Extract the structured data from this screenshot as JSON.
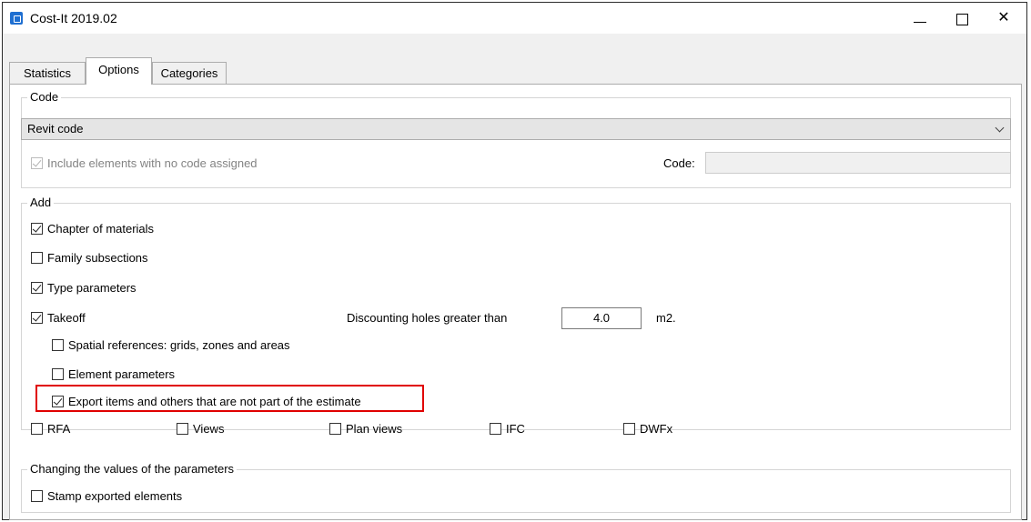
{
  "window": {
    "title": "Cost-It 2019.02",
    "minimize_glyph": "—",
    "maximize_glyph": "☐",
    "close_glyph": "✕"
  },
  "tabs": [
    {
      "label": "Statistics",
      "active": false
    },
    {
      "label": "Options",
      "active": true
    },
    {
      "label": "Categories",
      "active": false
    }
  ],
  "code_group": {
    "legend": "Code",
    "dropdown_value": "Revit code",
    "include_no_code": {
      "label": "Include elements with no code assigned",
      "checked": true,
      "enabled": false
    },
    "code_label": "Code:",
    "code_value": ""
  },
  "add_group": {
    "legend": "Add",
    "chapter_of_materials": {
      "label": "Chapter of materials",
      "checked": true
    },
    "family_subsections": {
      "label": "Family subsections",
      "checked": false
    },
    "type_parameters": {
      "label": "Type parameters",
      "checked": true
    },
    "takeoff": {
      "label": "Takeoff",
      "checked": true
    },
    "discounting_label": "Discounting holes greater than",
    "discounting_value": "4.0",
    "discounting_unit": "m2.",
    "spatial_references": {
      "label": "Spatial references: grids, zones and areas",
      "checked": false
    },
    "element_parameters": {
      "label": "Element parameters",
      "checked": false
    },
    "export_items": {
      "label": "Export items and others that are not part of the estimate",
      "checked": true,
      "highlighted": true
    },
    "rfa": {
      "label": "RFA",
      "checked": false
    },
    "views": {
      "label": "Views",
      "checked": false
    },
    "plan_views": {
      "label": "Plan views",
      "checked": false
    },
    "ifc": {
      "label": "IFC",
      "checked": false
    },
    "dwfx": {
      "label": "DWFx",
      "checked": false
    }
  },
  "params_group": {
    "legend": "Changing the values of the parameters",
    "stamp_exported": {
      "label": "Stamp exported elements",
      "checked": false
    }
  },
  "colors": {
    "highlight": "#e00000",
    "app_icon": "#1f6fd1"
  }
}
